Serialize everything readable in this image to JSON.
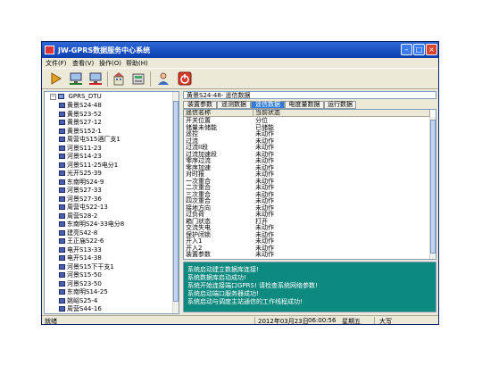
{
  "window": {
    "title": "JW-GPRS数据服务中心系统"
  },
  "menu": [
    "文件(F)",
    "查看(V)",
    "操作(O)",
    "帮助(H)"
  ],
  "toolbar": [
    "run-icon",
    "network-icon",
    "network-disconnect-icon",
    "building-icon",
    "settings-icon",
    "user-icon",
    "power-icon"
  ],
  "tree": {
    "root": "GPRS_DTU",
    "nodes": [
      "黄景S24-48",
      "黄景S23-52",
      "黄景S27-12",
      "黄景S152-1",
      "周营屯S15酒厂支1",
      "河景S11-23",
      "河景S14-23",
      "河景S11-25电分1",
      "光开S25-39",
      "东南明S24-9",
      "河景S27-33",
      "河景S27-36",
      "周营屯S22-13",
      "周营S28-2",
      "东南明S24-33电分8",
      "建亮S42-8",
      "王正庙S22-6",
      "电开S13-33",
      "电开S14-38",
      "河景S15下干支1",
      "河景S15-50",
      "河景S23-50",
      "东南明S14-25",
      "姚峪S25-4",
      "周营S44-16"
    ]
  },
  "right_header": "黄景S24-48- 遥信数据",
  "tabs": [
    "装置参数",
    "遥测数据",
    "遥信数据",
    "电度量数据",
    "运行数据"
  ],
  "grid": {
    "columns": [
      "遥信名称",
      "当前状态"
    ],
    "rows": [
      [
        "开关位置",
        "分位"
      ],
      [
        "储量未储能",
        "已储能"
      ],
      [
        "遥控",
        "未动作"
      ],
      [
        "过流",
        "未动作"
      ],
      [
        "过流II段",
        "未动作"
      ],
      [
        "过流加速段",
        "未动作"
      ],
      [
        "零序过流",
        "未动作"
      ],
      [
        "零序加速",
        "未动作"
      ],
      [
        "对时报",
        "未动作"
      ],
      [
        "一次重合",
        "未动作"
      ],
      [
        "二次重合",
        "未动作"
      ],
      [
        "三次重合",
        "未动作"
      ],
      [
        "四次重合",
        "未动作"
      ],
      [
        "接地方向",
        "未动作"
      ],
      [
        "过负荷",
        "未动作"
      ],
      [
        "箱门状态",
        "打开"
      ],
      [
        "交流失电",
        "未动作"
      ],
      [
        "保护闭锁",
        "未动作"
      ],
      [
        "开入1",
        "未动作"
      ],
      [
        "开入2",
        "未动作"
      ],
      [
        "装置参数",
        "未动作"
      ]
    ]
  },
  "log": [
    "系统启动建立数据库连接!",
    "系统数据库启动成功!",
    "系统开始连接端口GPRS! 请检查系统网络参数!",
    "系统启动端口服务器成功!",
    "系统启动与调度主站通信的工作线程成功!"
  ],
  "status": {
    "ready": "就绪",
    "date": "2012年03月23日",
    "time": "06:00:56",
    "weekday": "星期五",
    "caps": "大写"
  },
  "colors": {
    "title_bar": "#0a3fb0",
    "log_bg": "#0d8a80",
    "active_tab": "#2f7bd7"
  }
}
